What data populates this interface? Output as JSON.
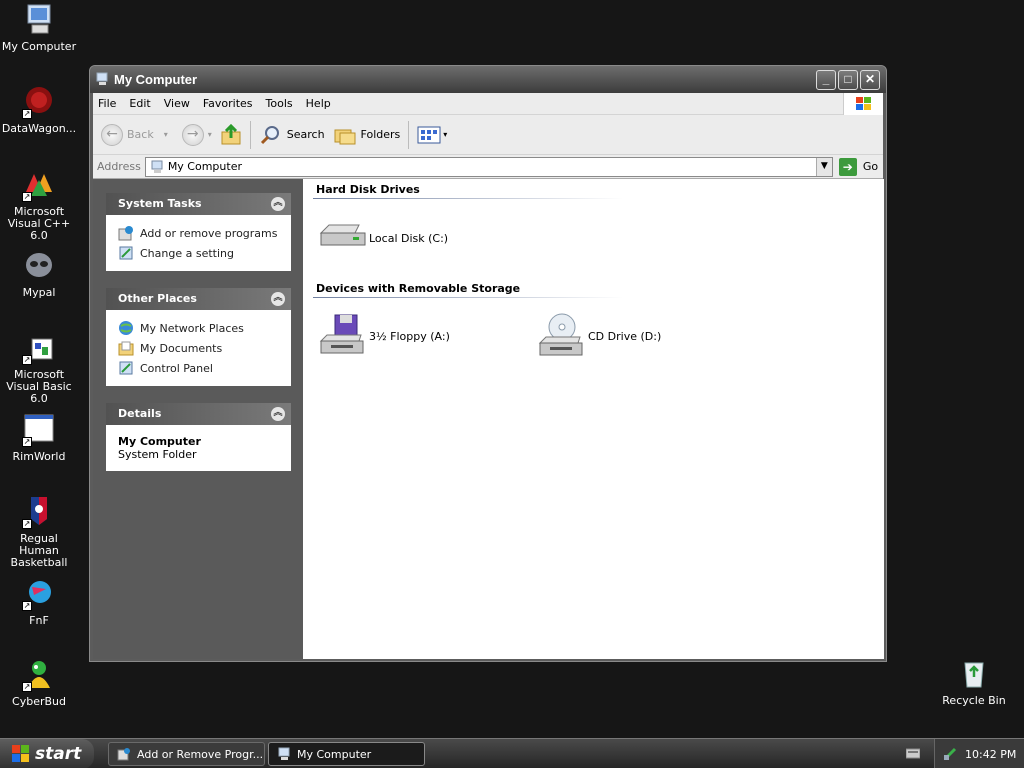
{
  "desktop": {
    "icons": [
      {
        "label": "My Computer"
      },
      {
        "label": "DataWagon..."
      },
      {
        "label": "Microsoft Visual C++ 6.0"
      },
      {
        "label": "Mypal"
      },
      {
        "label": "Microsoft Visual Basic 6.0"
      },
      {
        "label": "RimWorld"
      },
      {
        "label": "Regual Human Basketball"
      },
      {
        "label": "FnF"
      },
      {
        "label": "CyberBud"
      }
    ],
    "recycle_bin": "Recycle Bin"
  },
  "window": {
    "title": "My Computer",
    "menu": [
      "File",
      "Edit",
      "View",
      "Favorites",
      "Tools",
      "Help"
    ],
    "toolbar": {
      "back": "Back",
      "search": "Search",
      "folders": "Folders"
    },
    "address": {
      "label": "Address",
      "value": "My Computer",
      "go": "Go"
    },
    "panels": {
      "system_tasks": {
        "title": "System Tasks",
        "items": [
          "Add or remove programs",
          "Change a setting"
        ]
      },
      "other_places": {
        "title": "Other Places",
        "items": [
          "My Network Places",
          "My Documents",
          "Control Panel"
        ]
      },
      "details": {
        "title": "Details",
        "name": "My Computer",
        "type": "System Folder"
      }
    },
    "groups": {
      "hard_disks": {
        "title": "Hard Disk Drives",
        "items": [
          "Local Disk (C:)"
        ]
      },
      "removable": {
        "title": "Devices with Removable Storage",
        "items": [
          "3½ Floppy (A:)",
          "CD Drive (D:)"
        ]
      }
    }
  },
  "taskbar": {
    "start": "start",
    "tasks": [
      "Add or Remove Progr...",
      "My Computer"
    ],
    "clock": "10:42 PM"
  }
}
